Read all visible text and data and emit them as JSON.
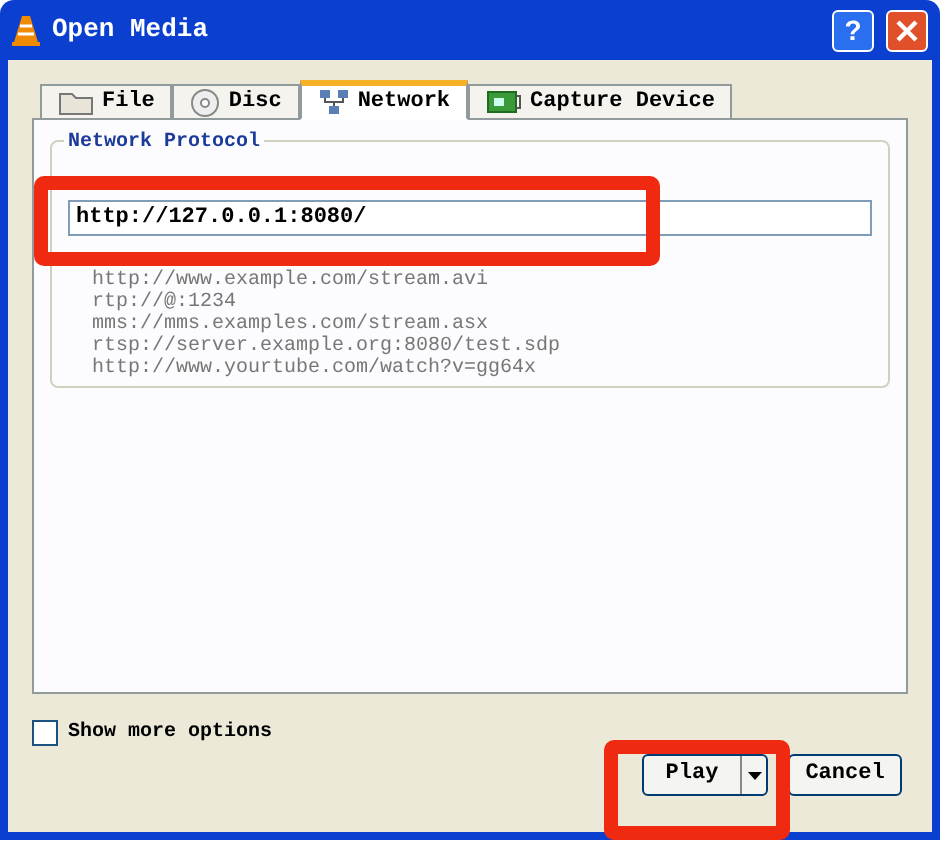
{
  "window": {
    "title": "Open Media",
    "help_button": "?"
  },
  "tabs": [
    {
      "label": "File",
      "kind": "folder",
      "selected": false
    },
    {
      "label": "Disc",
      "kind": "disc",
      "selected": false
    },
    {
      "label": "Network",
      "kind": "network",
      "selected": true
    },
    {
      "label": "Capture Device",
      "kind": "capture",
      "selected": false
    }
  ],
  "network_protocol": {
    "title": "Network Protocol",
    "url_field": {
      "value": "http://127.0.0.1:8080/"
    },
    "examples": [
      "http://www.example.com/stream.avi",
      "rtp://@:1234",
      "mms://mms.examples.com/stream.asx",
      "rtsp://server.example.org:8080/test.sdp",
      "http://www.yourtube.com/watch?v=gg64x"
    ]
  },
  "show_more_options": {
    "label": "Show more options",
    "checked": false
  },
  "buttons": [
    {
      "label": "Play",
      "kind": "split"
    },
    {
      "label": "Cancel",
      "kind": "plain"
    }
  ]
}
